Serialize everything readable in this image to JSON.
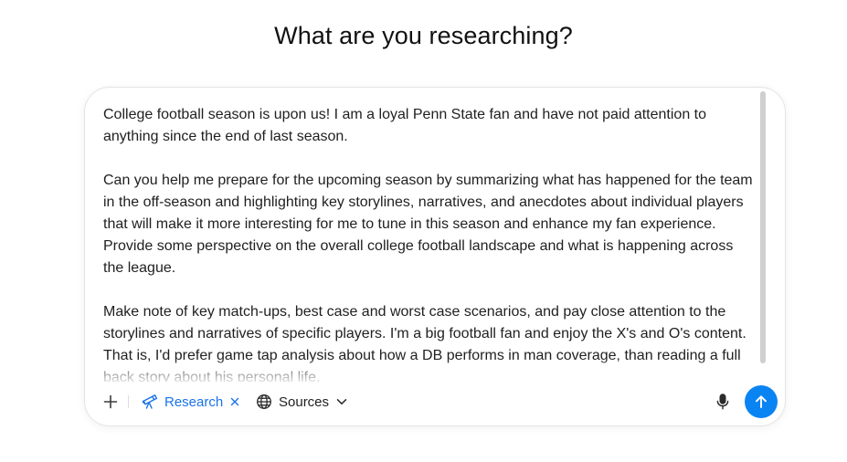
{
  "page": {
    "heading": "What are you researching?"
  },
  "composer": {
    "prompt_paragraphs": [
      "College football season is upon us! I am a loyal Penn State fan and have not paid attention to anything since the end of last season.",
      "Can you help me prepare for the upcoming season by summarizing what has happened for the team in the off-season and highlighting key storylines, narratives, and anecdotes about individual players that will make it more interesting for me to tune in this season and enhance my fan experience. Provide some perspective on the overall college football landscape and what is happening across the league.",
      "Make note of key match-ups, best case and worst case scenarios, and pay close attention to the storylines and narratives of specific players. I'm a big football fan and enjoy the X's and O's content. That is, I'd prefer game tap analysis about how a DB performs in man coverage, than reading a full back story about his personal life."
    ]
  },
  "toolbar": {
    "add_icon": "plus-icon",
    "research_chip": {
      "label": "Research",
      "icon": "telescope-icon",
      "remove_icon": "close-icon",
      "color": "#1a73e8"
    },
    "sources": {
      "label": "Sources",
      "icon": "globe-icon",
      "dropdown_icon": "chevron-down-icon"
    },
    "mic_icon": "microphone-icon",
    "send": {
      "icon": "arrow-up-icon",
      "color": "#0b84f3"
    }
  }
}
